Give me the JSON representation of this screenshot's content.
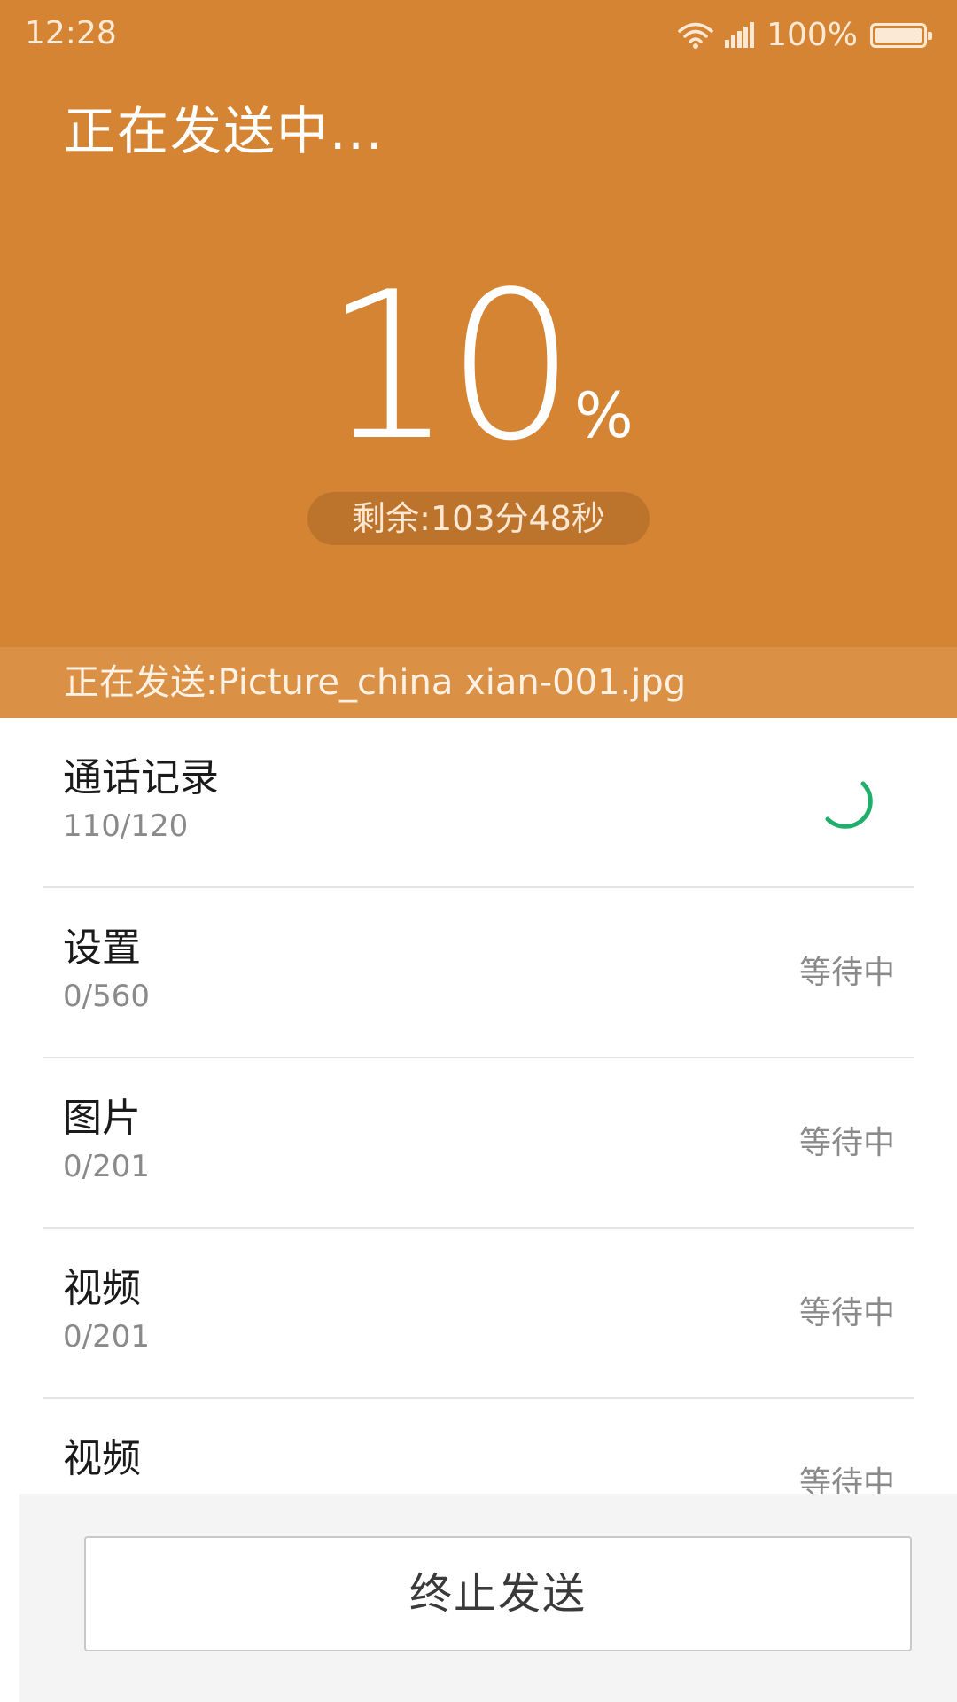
{
  "status_bar": {
    "time": "12:28",
    "battery_percent": "100%",
    "icons": [
      "wifi-icon",
      "signal-icon",
      "battery-icon"
    ]
  },
  "header": {
    "title": "正在发送中...",
    "progress_value": "10",
    "progress_unit": "%",
    "remaining": "剩余:103分48秒",
    "current_file": "正在发送:Picture_china xian-001.jpg"
  },
  "list": {
    "items": [
      {
        "title": "通话记录",
        "count": "110/120",
        "status": "",
        "icon": "loading-spinner-icon"
      },
      {
        "title": "设置",
        "count": "0/560",
        "status": "等待中"
      },
      {
        "title": "图片",
        "count": "0/201",
        "status": "等待中"
      },
      {
        "title": "视频",
        "count": "0/201",
        "status": "等待中"
      },
      {
        "title": "视频",
        "count": "",
        "status": "等待中"
      }
    ]
  },
  "footer": {
    "stop_button_label": "终止发送"
  },
  "colors": {
    "header_bg": "#D48432",
    "pill_bg": "#BC732C",
    "file_bar_bg": "#DA9146",
    "spinner": "#1FAF6A"
  }
}
